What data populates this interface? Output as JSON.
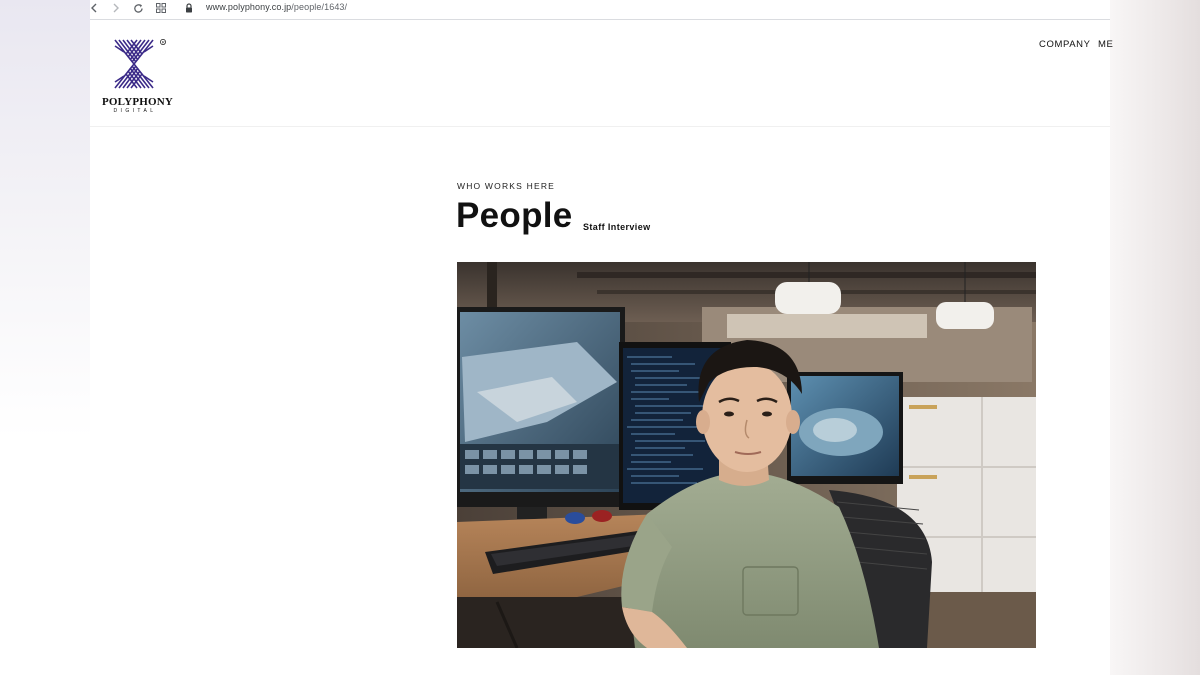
{
  "browser": {
    "url_domain": "www.polyphony.co.jp",
    "url_path": "/people/1643/"
  },
  "header": {
    "logo_text": "POLYPHONY",
    "logo_subtext": "DIGITAL",
    "nav": [
      "COMPANY",
      "ME"
    ]
  },
  "main": {
    "eyebrow": "WHO WORKS HERE",
    "title": "People",
    "subtitle": "Staff Interview"
  },
  "colors": {
    "logo_purple": "#3b2a88",
    "text": "#111111"
  },
  "icons": [
    "back-arrow-icon",
    "forward-arrow-icon",
    "reload-icon",
    "apps-grid-icon",
    "lock-icon"
  ]
}
